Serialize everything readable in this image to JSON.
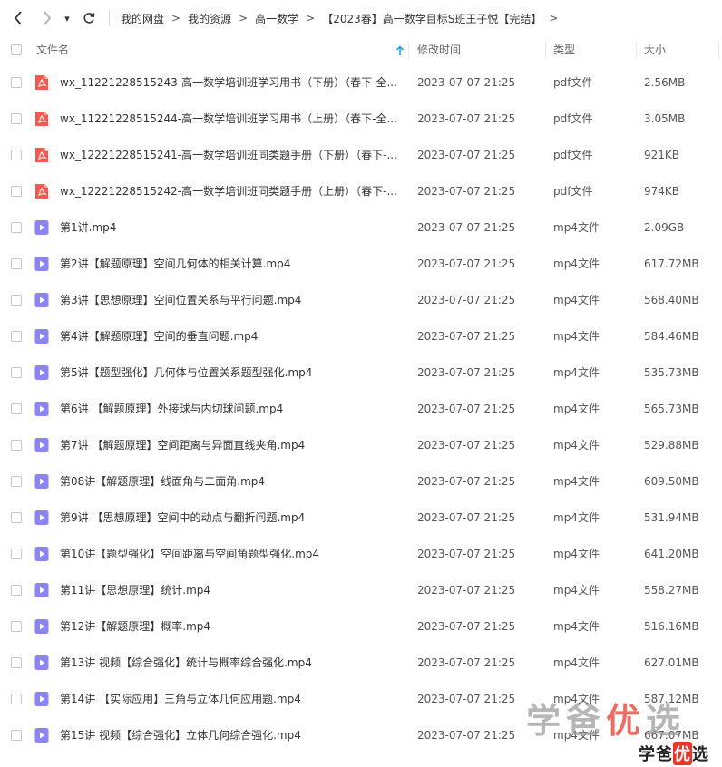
{
  "nav": {
    "dropdown_glyph": "▾"
  },
  "breadcrumb": {
    "separator": ">",
    "items": [
      "我的网盘",
      "我的资源",
      "高一数学",
      "【2023春】高一数学目标S班王子悦【完结】"
    ],
    "trailing_arrow": ">"
  },
  "columns": {
    "name": "文件名",
    "modified": "修改时间",
    "type": "类型",
    "size": "大小"
  },
  "colors": {
    "pdf_icon": "#f25a4d",
    "video_icon": "#8a84f5",
    "sort_arrow": "#2f9bf0",
    "watermark_red": "#e7362a"
  },
  "files": [
    {
      "icon": "pdf-icon",
      "name": "wx_11221228515243-高一数学培训班学习用书（下册）（春下-全...",
      "modified": "2023-07-07 21:25",
      "type": "pdf文件",
      "size": "2.56MB"
    },
    {
      "icon": "pdf-icon",
      "name": "wx_11221228515244-高一数学培训班学习用书（上册）（春下-全...",
      "modified": "2023-07-07 21:25",
      "type": "pdf文件",
      "size": "3.05MB"
    },
    {
      "icon": "pdf-icon",
      "name": "wx_12221228515241-高一数学培训班同类题手册（下册）（春下-...",
      "modified": "2023-07-07 21:25",
      "type": "pdf文件",
      "size": "921KB"
    },
    {
      "icon": "pdf-icon",
      "name": "wx_12221228515242-高一数学培训班同类题手册（上册）（春下-...",
      "modified": "2023-07-07 21:25",
      "type": "pdf文件",
      "size": "974KB"
    },
    {
      "icon": "video-icon",
      "name": "第1讲.mp4",
      "modified": "2023-07-07 21:25",
      "type": "mp4文件",
      "size": "2.09GB"
    },
    {
      "icon": "video-icon",
      "name": "第2讲【解题原理】空间几何体的相关计算.mp4",
      "modified": "2023-07-07 21:25",
      "type": "mp4文件",
      "size": "617.72MB"
    },
    {
      "icon": "video-icon",
      "name": "第3讲【思想原理】空间位置关系与平行问题.mp4",
      "modified": "2023-07-07 21:25",
      "type": "mp4文件",
      "size": "568.40MB"
    },
    {
      "icon": "video-icon",
      "name": "第4讲【解题原理】空间的垂直问题.mp4",
      "modified": "2023-07-07 21:25",
      "type": "mp4文件",
      "size": "584.46MB"
    },
    {
      "icon": "video-icon",
      "name": "第5讲【题型强化】几何体与位置关系题型强化.mp4",
      "modified": "2023-07-07 21:25",
      "type": "mp4文件",
      "size": "535.73MB"
    },
    {
      "icon": "video-icon",
      "name": "第6讲 【解题原理】外接球与内切球问题.mp4",
      "modified": "2023-07-07 21:25",
      "type": "mp4文件",
      "size": "565.73MB"
    },
    {
      "icon": "video-icon",
      "name": "第7讲 【解题原理】空间距离与异面直线夹角.mp4",
      "modified": "2023-07-07 21:25",
      "type": "mp4文件",
      "size": "529.88MB"
    },
    {
      "icon": "video-icon",
      "name": "第08讲【解题原理】线面角与二面角.mp4",
      "modified": "2023-07-07 21:25",
      "type": "mp4文件",
      "size": "609.50MB"
    },
    {
      "icon": "video-icon",
      "name": "第9讲 【思想原理】空间中的动点与翻折问题.mp4",
      "modified": "2023-07-07 21:25",
      "type": "mp4文件",
      "size": "531.94MB"
    },
    {
      "icon": "video-icon",
      "name": "第10讲【题型强化】空间距离与空间角题型强化.mp4",
      "modified": "2023-07-07 21:25",
      "type": "mp4文件",
      "size": "641.20MB"
    },
    {
      "icon": "video-icon",
      "name": "第11讲【思想原理】统计.mp4",
      "modified": "2023-07-07 21:25",
      "type": "mp4文件",
      "size": "558.27MB"
    },
    {
      "icon": "video-icon",
      "name": "第12讲【解题原理】概率.mp4",
      "modified": "2023-07-07 21:25",
      "type": "mp4文件",
      "size": "516.16MB"
    },
    {
      "icon": "video-icon",
      "name": "第13讲 视频【综合强化】统计与概率综合强化.mp4",
      "modified": "2023-07-07 21:25",
      "type": "mp4文件",
      "size": "627.01MB"
    },
    {
      "icon": "video-icon",
      "name": "第14讲 【实际应用】三角与立体几何应用题.mp4",
      "modified": "2023-07-07 21:25",
      "type": "mp4文件",
      "size": "587.12MB"
    },
    {
      "icon": "video-icon",
      "name": "第15讲 视频【综合强化】立体几何综合强化.mp4",
      "modified": "2023-07-07 21:25",
      "type": "mp4文件",
      "size": "667.07MB"
    }
  ],
  "watermark": {
    "large": [
      "学",
      "爸",
      "优",
      "选"
    ],
    "small": [
      "学",
      "爸",
      "优",
      "选"
    ]
  }
}
